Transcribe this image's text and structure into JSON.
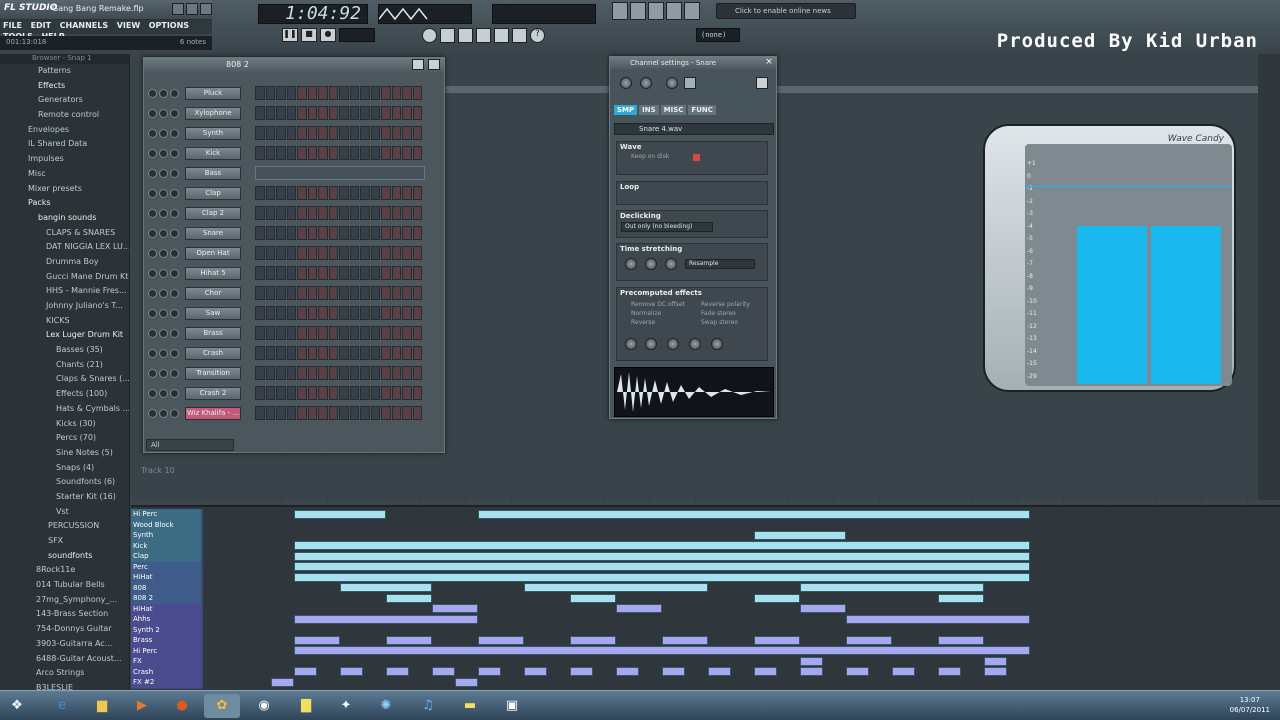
{
  "app": {
    "logo": "FL STUDIO",
    "project_title": "Gang Bang Remake.flp",
    "time": "1:04:92",
    "hint_left": "001:13:018",
    "hint_right": "6 notes",
    "online_news": "Click to enable online news",
    "none_label": "(none)",
    "pattern_display": "808 2"
  },
  "menu": [
    "FILE",
    "EDIT",
    "CHANNELS",
    "VIEW",
    "OPTIONS",
    "TOOLS",
    "HELP"
  ],
  "watermark": "Produced By Kid Urban",
  "browser": {
    "header": "Browser - Snap 1",
    "items": [
      "Patterns",
      "Effects",
      "Generators",
      "Remote control",
      "Envelopes",
      "IL Shared Data",
      "Impulses",
      "Misc",
      "Mixer presets",
      "Packs",
      "bangin sounds",
      "CLAPS & SNARES",
      "DAT NIGGIA LEX LU...",
      "Drumma Boy",
      "Gucci Mane Drum Kt",
      "HHS - Mannie Fres...",
      "Johnny Juliano's T...",
      "KICKS",
      "Lex Luger Drum Kit",
      "Basses (35)",
      "Chants (21)",
      "Claps & Snares (...",
      "Effects (100)",
      "Hats & Cymbals ...",
      "Kicks (30)",
      "Percs (70)",
      "Sine Notes (5)",
      "Snaps (4)",
      "Soundfonts (6)",
      "Starter Kit (16)",
      "Vst",
      "PERCUSSION",
      "SFX",
      "soundfonts",
      "8Rock11e",
      "014 Tubular Bells",
      "27mg_Symphony_...",
      "143-Brass Section",
      "754-Donnys Guitar",
      "3903-Guitarra Ac...",
      "6488-Guitar Acoust...",
      "Arco Strings",
      "B3LESLIE",
      "Ballad Brass Ensem..."
    ]
  },
  "stepseq": {
    "channels": [
      "Pluck",
      "Xylophone",
      "Synth",
      "Kick",
      "Bass",
      "Clap",
      "Clap 2",
      "Snare",
      "Open Hat",
      "Hihat 5",
      "Chor",
      "Saw",
      "Brass",
      "Crash",
      "Transition",
      "Crash 2",
      "Wiz Khalifa - ..."
    ],
    "filter": "All"
  },
  "chset": {
    "title": "Channel settings - Snare",
    "tabs": [
      "SMP",
      "INS",
      "MISC",
      "FUNC"
    ],
    "sample": "Snare 4.wav",
    "wave_label": "Wave",
    "keep_on_disk": "Keep on disk",
    "loop_label": "Loop",
    "declicking_label": "Declicking",
    "declicking_value": "Out only (no bleeding)",
    "time_label": "Time stretching",
    "time_mode": "Resample",
    "precomp_label": "Precomputed effects",
    "precomp_opts": [
      "Remove DC offset",
      "Normalize",
      "Reverse",
      "Reverse polarity",
      "Fade stereo",
      "Swap stereo"
    ]
  },
  "wavecandy": {
    "title": "Wave Candy",
    "levels": [
      0.95,
      0.95
    ],
    "scale": [
      "+1",
      "0",
      "-1",
      "-2",
      "-3",
      "-4",
      "-5",
      "-6",
      "-7",
      "-8",
      "-9",
      "-10",
      "-11",
      "-12",
      "-13",
      "-14",
      "-15",
      "-29"
    ]
  },
  "playlist": {
    "track_label": "Track 10",
    "tracks": [
      "Hi Perc",
      "Wood Block",
      "Synth",
      "Kick",
      "Clap",
      "Perc",
      "HiHat",
      "808",
      "808 2",
      "HiHat",
      "Ahhs",
      "Synth 2",
      "Brass",
      "Hi Perc",
      "FX",
      "Crash",
      "FX #2"
    ]
  },
  "taskbar": {
    "time": "13:07",
    "date": "06/07/2011"
  },
  "colors": {
    "pattern_block": "#a8e0ee",
    "pattern_block_violet": "#a9a6f0",
    "wave_candy_bar": "#1ab8ec",
    "step_red": "#5a3f44"
  }
}
